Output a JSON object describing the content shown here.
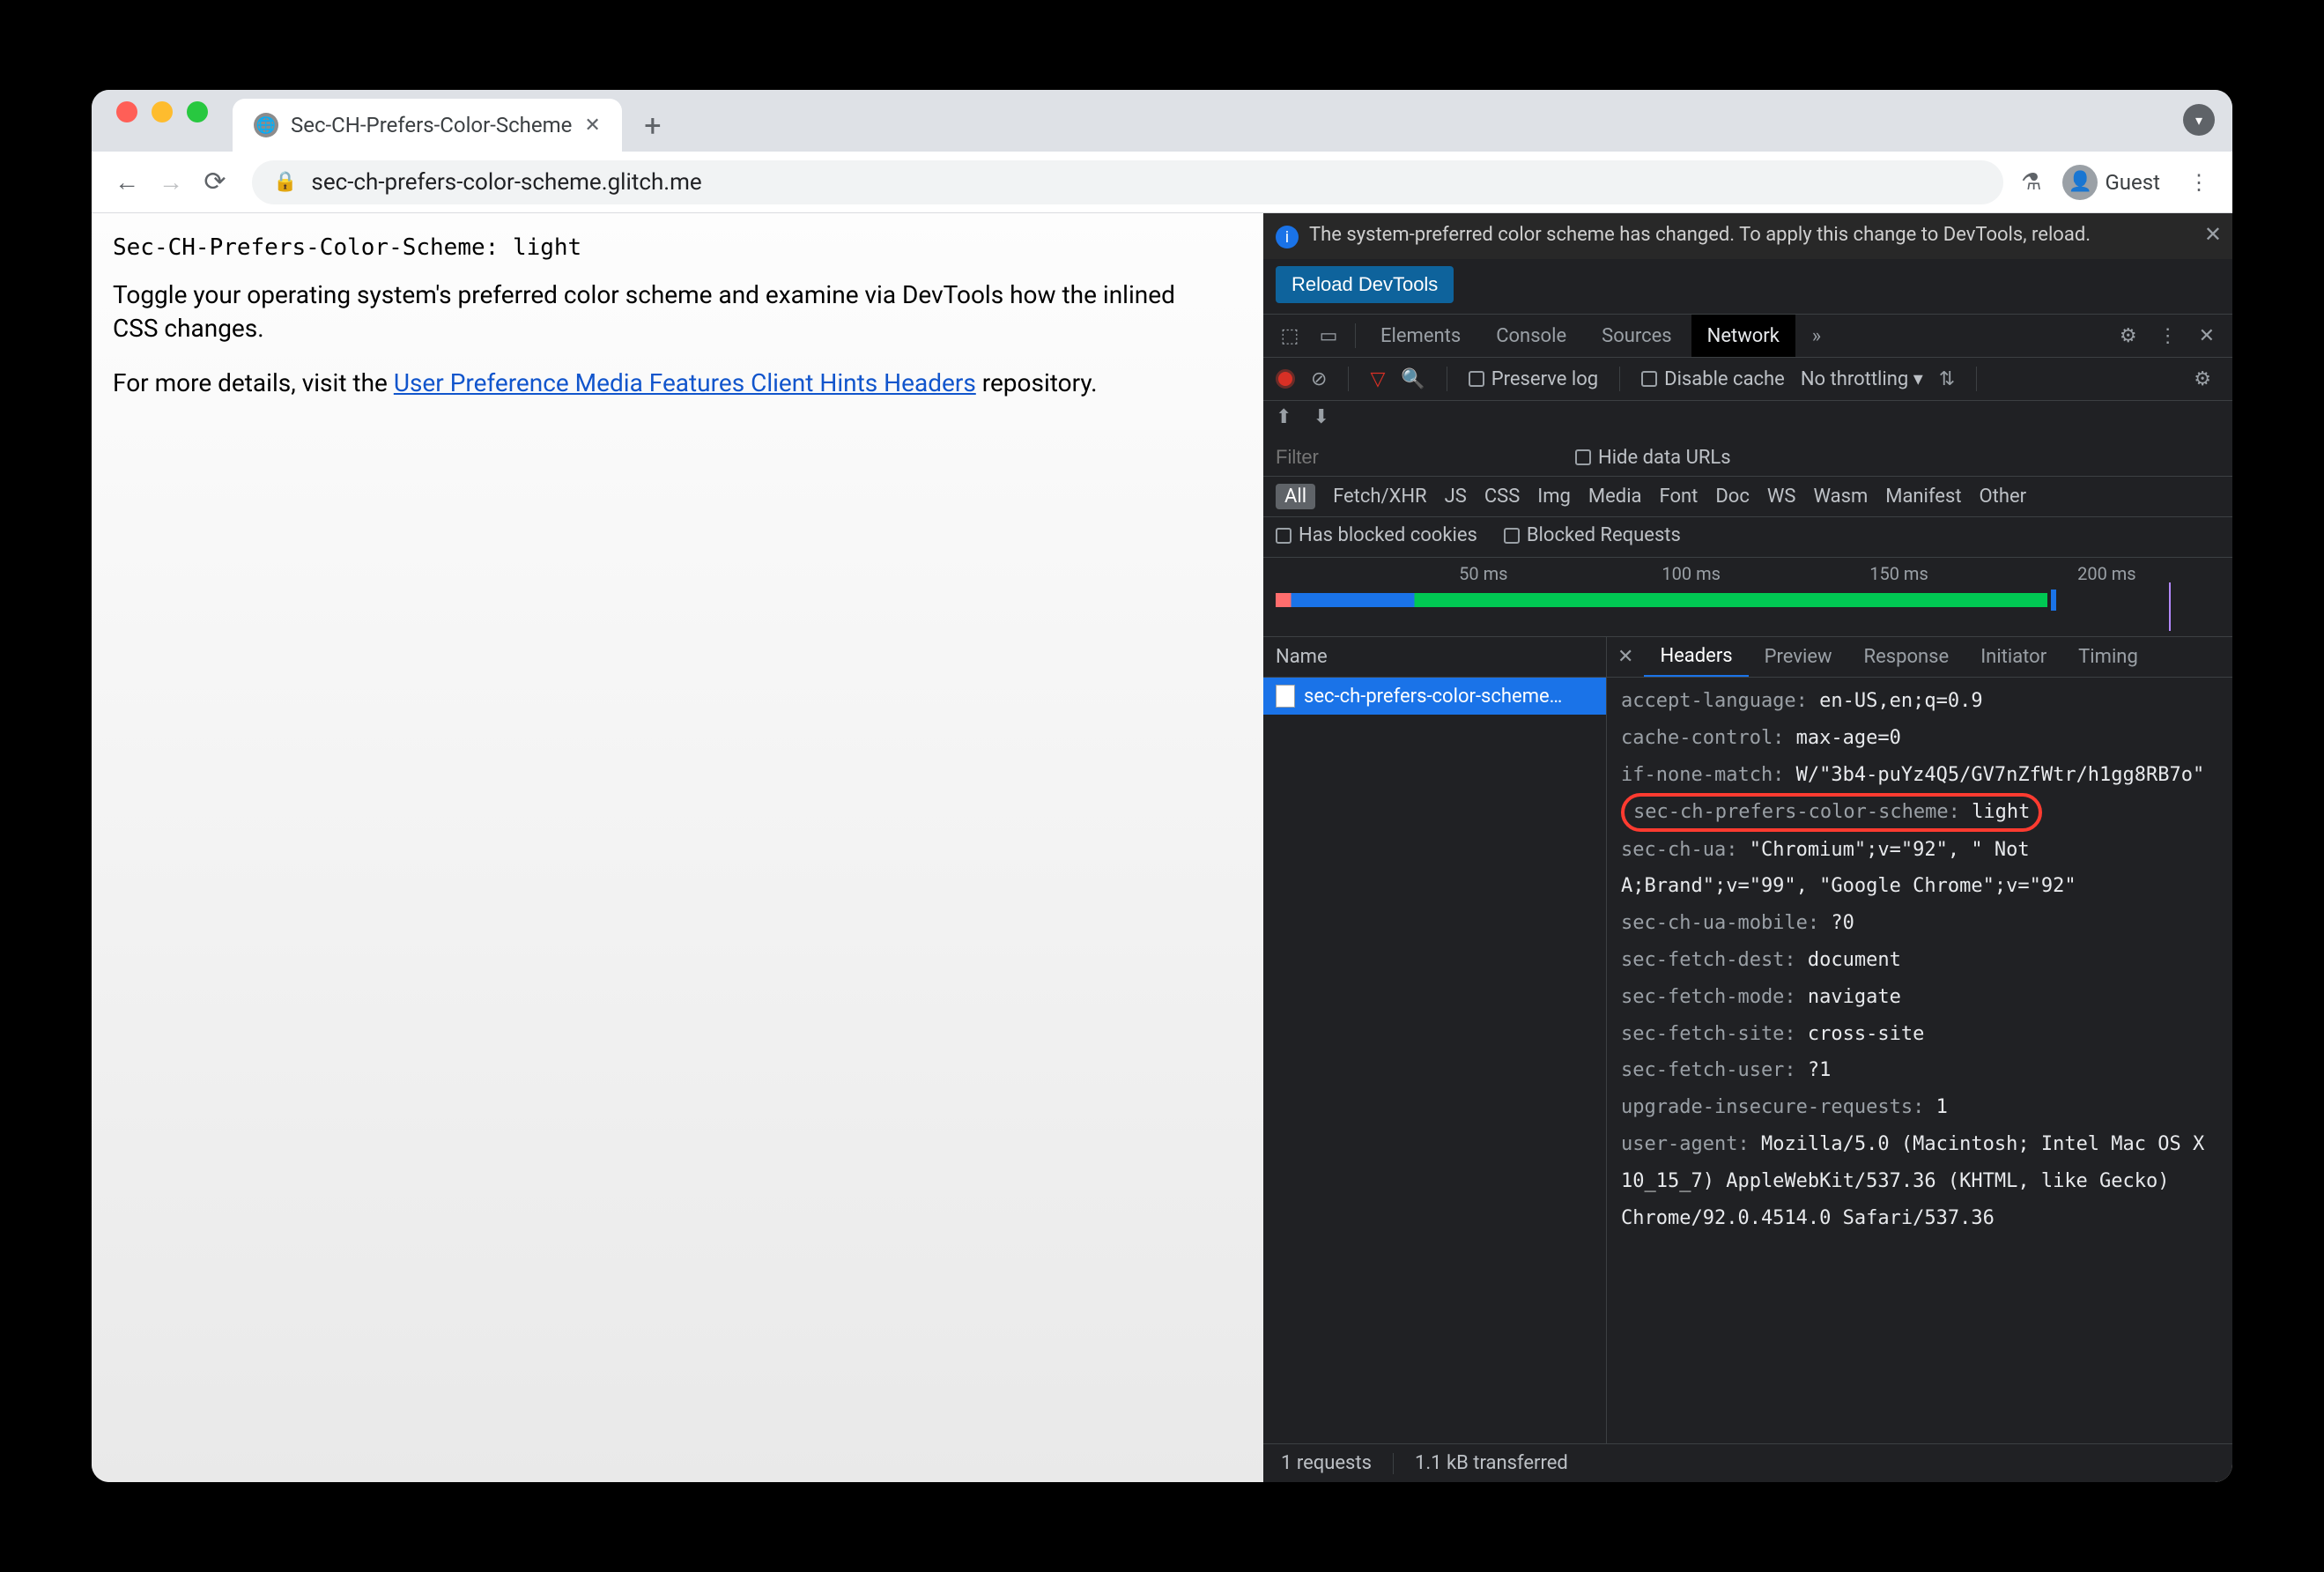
{
  "tab": {
    "title": "Sec-CH-Prefers-Color-Scheme"
  },
  "url": "sec-ch-prefers-color-scheme.glitch.me",
  "profile": "Guest",
  "page": {
    "mono": "Sec-CH-Prefers-Color-Scheme: light",
    "para1": "Toggle your operating system's preferred color scheme and examine via DevTools how the inlined CSS changes.",
    "para2_pre": "For more details, visit the ",
    "para2_link": "User Preference Media Features Client Hints Headers",
    "para2_post": " repository."
  },
  "devtools": {
    "banner": "The system-preferred color scheme has changed. To apply this change to DevTools, reload.",
    "reload": "Reload DevTools",
    "tabs": {
      "elements": "Elements",
      "console": "Console",
      "sources": "Sources",
      "network": "Network"
    },
    "net": {
      "preserve": "Preserve log",
      "disable": "Disable cache",
      "throttle": "No throttling",
      "filter_ph": "Filter",
      "hideurls": "Hide data URLs",
      "types": [
        "All",
        "Fetch/XHR",
        "JS",
        "CSS",
        "Img",
        "Media",
        "Font",
        "Doc",
        "WS",
        "Wasm",
        "Manifest",
        "Other"
      ],
      "blocked_cookies": "Has blocked cookies",
      "blocked_req": "Blocked Requests",
      "ticks": [
        "50 ms",
        "100 ms",
        "150 ms",
        "200 ms"
      ]
    },
    "namecol": "Name",
    "request": "sec-ch-prefers-color-scheme…",
    "dtabs": {
      "headers": "Headers",
      "preview": "Preview",
      "response": "Response",
      "initiator": "Initiator",
      "timing": "Timing"
    },
    "headers": [
      {
        "k": "accept-language:",
        "v": " en-US,en;q=0.9"
      },
      {
        "k": "cache-control:",
        "v": " max-age=0"
      },
      {
        "k": "if-none-match:",
        "v": " W/\"3b4-puYz4Q5/GV7nZfWtr/h1gg8RB7o\""
      },
      {
        "k": "sec-ch-prefers-color-scheme:",
        "v": " light",
        "hl": true
      },
      {
        "k": "sec-ch-ua:",
        "v": " \"Chromium\";v=\"92\", \" Not A;Brand\";v=\"99\", \"Google Chrome\";v=\"92\""
      },
      {
        "k": "sec-ch-ua-mobile:",
        "v": " ?0"
      },
      {
        "k": "sec-fetch-dest:",
        "v": " document"
      },
      {
        "k": "sec-fetch-mode:",
        "v": " navigate"
      },
      {
        "k": "sec-fetch-site:",
        "v": " cross-site"
      },
      {
        "k": "sec-fetch-user:",
        "v": " ?1"
      },
      {
        "k": "upgrade-insecure-requests:",
        "v": " 1"
      },
      {
        "k": "user-agent:",
        "v": " Mozilla/5.0 (Macintosh; Intel Mac OS X 10_15_7) AppleWebKit/537.36 (KHTML, like Gecko) Chrome/92.0.4514.0 Safari/537.36"
      }
    ],
    "status": {
      "requests": "1 requests",
      "transferred": "1.1 kB transferred"
    }
  }
}
